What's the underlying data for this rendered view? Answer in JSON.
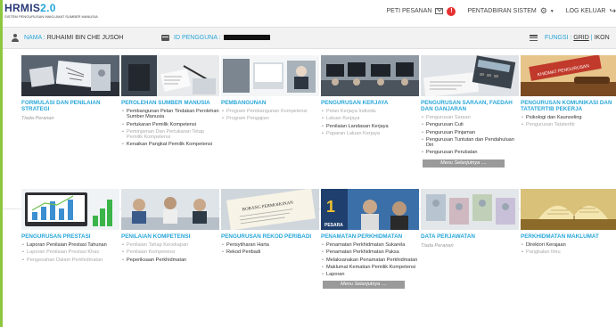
{
  "header": {
    "logo": "HRMIS",
    "logo_version": "2.0",
    "logo_subtitle": "SISTEM PENGURUSAN MAKLUMAT SUMBER MANUSIA",
    "nav": {
      "messages": "PETI PESANAN",
      "message_count": "!",
      "admin": "PENTADBIRAN SISTEM",
      "logout": "LOG KELUAR"
    }
  },
  "infobar": {
    "name_label": "NAMA :",
    "name_value": "RUHAIMI BIN CHE JUSOH",
    "id_label": "ID PENGGUNA :",
    "fungsi_label": "FUNGSI :",
    "fungsi_grid": "GRID",
    "fungsi_sep": "|",
    "fungsi_ikon": "IKON"
  },
  "tiles_row1": [
    {
      "title": "FORMULASI DAN PENILAIAN STRATEGI",
      "empty": "Tiada Peranan",
      "items": []
    },
    {
      "title": "PEROLEHAN SUMBER MANUSIA",
      "items": [
        {
          "text": "Pembangunan Pelan Tindakan Perolehan Sumber Manusia",
          "dim": false
        },
        {
          "text": "Pertukaran Pemilik Kompetensi",
          "dim": false
        },
        {
          "text": "Peminjaman Dan Pertukaran Tetap Pemilik Kompetensi",
          "dim": true
        },
        {
          "text": "Kenaikan Pangkat Pemilik Kompetensi",
          "dim": false
        }
      ]
    },
    {
      "title": "PEMBANGUNAN",
      "items": [
        {
          "text": "Program Pembangunan Kompetensi",
          "dim": true
        },
        {
          "text": "Program Pengajian",
          "dim": true
        }
      ]
    },
    {
      "title": "PENGURUSAN KERJAYA",
      "items": [
        {
          "text": "Pelan Kerjaya Individu",
          "dim": true
        },
        {
          "text": "Laluan Kerjaya",
          "dim": true
        },
        {
          "text": "Penilaian Landasan Kerjaya",
          "dim": false
        },
        {
          "text": "Paparan Laluan Kerjaya",
          "dim": true
        }
      ]
    },
    {
      "title": "PENGURUSAN SARAAN, FAEDAH DAN GANJARAN",
      "more": "Menu Selanjutnya ....",
      "items": [
        {
          "text": "Pengurusan Saraan",
          "dim": true
        },
        {
          "text": "Pengurusan Cuti",
          "dim": false
        },
        {
          "text": "Pengurusan Pinjaman",
          "dim": false
        },
        {
          "text": "Pengurusan Tuntutan dan Pendahuluan Diri",
          "dim": false
        },
        {
          "text": "Pengurusan Perubatan",
          "dim": false
        }
      ]
    },
    {
      "title": "PENGURUSAN KOMUNIKASI DAN TATATERTIB PEKERJA",
      "items": [
        {
          "text": "Psikologi dan Kaunseling",
          "dim": false
        },
        {
          "text": "Pengurusan Tatatertib",
          "dim": true
        }
      ]
    }
  ],
  "tiles_row2": [
    {
      "title": "PENGURUSAN PRESTASI",
      "items": [
        {
          "text": "Laporan Penilaian Prestasi Tahunan",
          "dim": false
        },
        {
          "text": "Laporan Penilaian Prestasi Khas",
          "dim": true
        },
        {
          "text": "Pengesahan Dalam Perkhidmatan",
          "dim": true
        }
      ]
    },
    {
      "title": "PENILAIAN KOMPETENSI",
      "items": [
        {
          "text": "Penilaian Tahap Kecekapan",
          "dim": true
        },
        {
          "text": "Penilaian Kompetensi",
          "dim": true
        },
        {
          "text": "Peperiksaan Perkhidmatan",
          "dim": false
        }
      ]
    },
    {
      "title": "PENGURUSAN REKOD PERIBADI",
      "items": [
        {
          "text": "Perisytiharan Harta",
          "dim": false
        },
        {
          "text": "Rekod Peribadi",
          "dim": false
        }
      ]
    },
    {
      "title": "PENAMATAN PERKHIDMATAN",
      "more": "Menu Selanjutnya ....",
      "items": [
        {
          "text": "Penamatan Perkhidmatan Sukarela",
          "dim": false
        },
        {
          "text": "Penamatan Perkhidmatan Paksa",
          "dim": false
        },
        {
          "text": "Melaksanakan Penamatan Perkhidmatan",
          "dim": false
        },
        {
          "text": "Maklumat Kematian Pemilik Kompetensi",
          "dim": false
        },
        {
          "text": "Laporan",
          "dim": false
        }
      ]
    },
    {
      "title": "DATA PERJAWATAN",
      "empty": "Tiada Peranan",
      "items": []
    },
    {
      "title": "PERKHIDMATAN MAKLUMAT",
      "items": [
        {
          "text": "Direktori Kerajaan",
          "dim": false
        },
        {
          "text": "Pangkalan Ilmu",
          "dim": true
        }
      ]
    }
  ],
  "image_text": {
    "kerjaya_sign": "",
    "pesara_sign": "PESARA",
    "komunikasi_sign": "KHIDMAT PENGURUSAN",
    "rekod_paper": "BORANG PERMOHONAN"
  }
}
